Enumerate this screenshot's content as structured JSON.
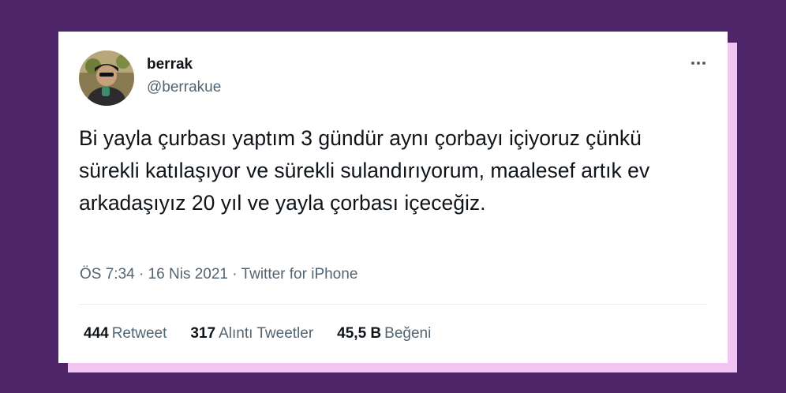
{
  "tweet": {
    "author_name": "berrak",
    "author_handle": "@berrakue",
    "text": "Bi yayla çurbası yaptım 3 gündür aynı çorbayı içiyoruz çünkü sürekli katılaşıyor ve sürekli sulandırıyorum, maalesef artık ev arkadaşıyız 20 yıl ve yayla çorbası içeceğiz.",
    "meta": "ÖS 7:34 · 16 Nis 2021 · Twitter for iPhone",
    "more_icon": "more-horizontal-icon"
  },
  "stats": {
    "retweets_count": "444",
    "retweets_label": "Retweet",
    "quotes_count": "317",
    "quotes_label": "Alıntı Tweetler",
    "likes_count": "45,5 B",
    "likes_label": "Beğeni"
  },
  "colors": {
    "background": "#4e2568",
    "accent_shadow": "#f2c4f2",
    "text_primary": "#0f1419",
    "text_secondary": "#536471"
  }
}
